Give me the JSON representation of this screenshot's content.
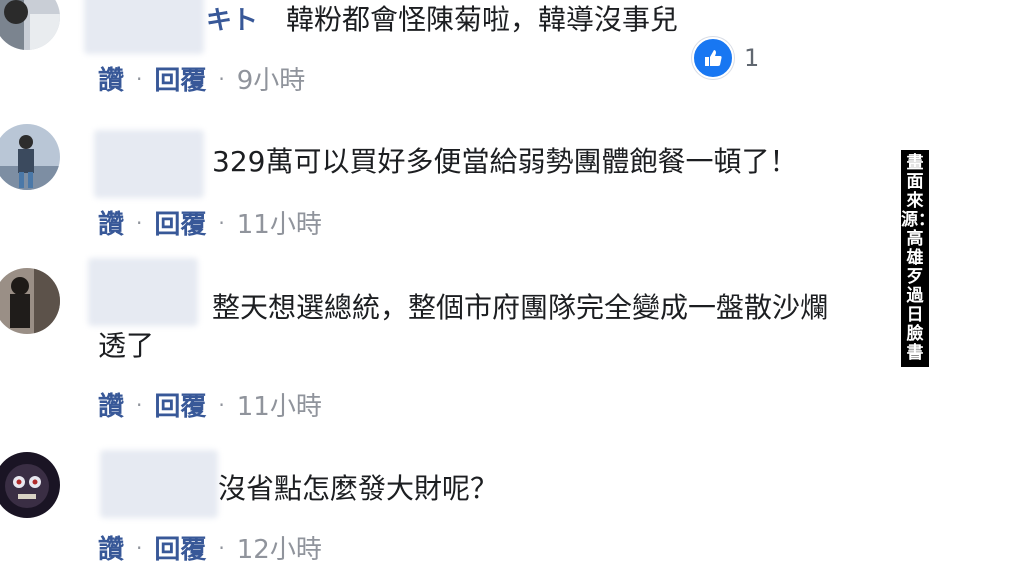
{
  "comments": [
    {
      "name_suffix": "キト",
      "text": "韓粉都會怪陳菊啦，韓導沒事兒",
      "like_label": "讚",
      "reply_label": "回覆",
      "time": "9小時",
      "reaction_count": "1",
      "reaction_icon": "thumbs-up-icon",
      "accent": "#1877f2"
    },
    {
      "name_suffix": "",
      "text": "329萬可以買好多便當給弱勢團體飽餐一頓了！",
      "like_label": "讚",
      "reply_label": "回覆",
      "time": "11小時"
    },
    {
      "name_suffix": "",
      "text_line1": "整天想選總統，整個市府團隊完全變成一盤散沙爛",
      "text_line2": "透了",
      "like_label": "讚",
      "reply_label": "回覆",
      "time": "11小時"
    },
    {
      "name_suffix": "",
      "text": "沒省點怎麼發大財呢？",
      "like_label": "讚",
      "reply_label": "回覆",
      "time": "12小時"
    }
  ],
  "watermark": "畫面來源：高雄歹過日臉書",
  "colors": {
    "link": "#385898",
    "meta": "#90949c",
    "text": "#1c1e21",
    "like_blue": "#1877f2"
  }
}
